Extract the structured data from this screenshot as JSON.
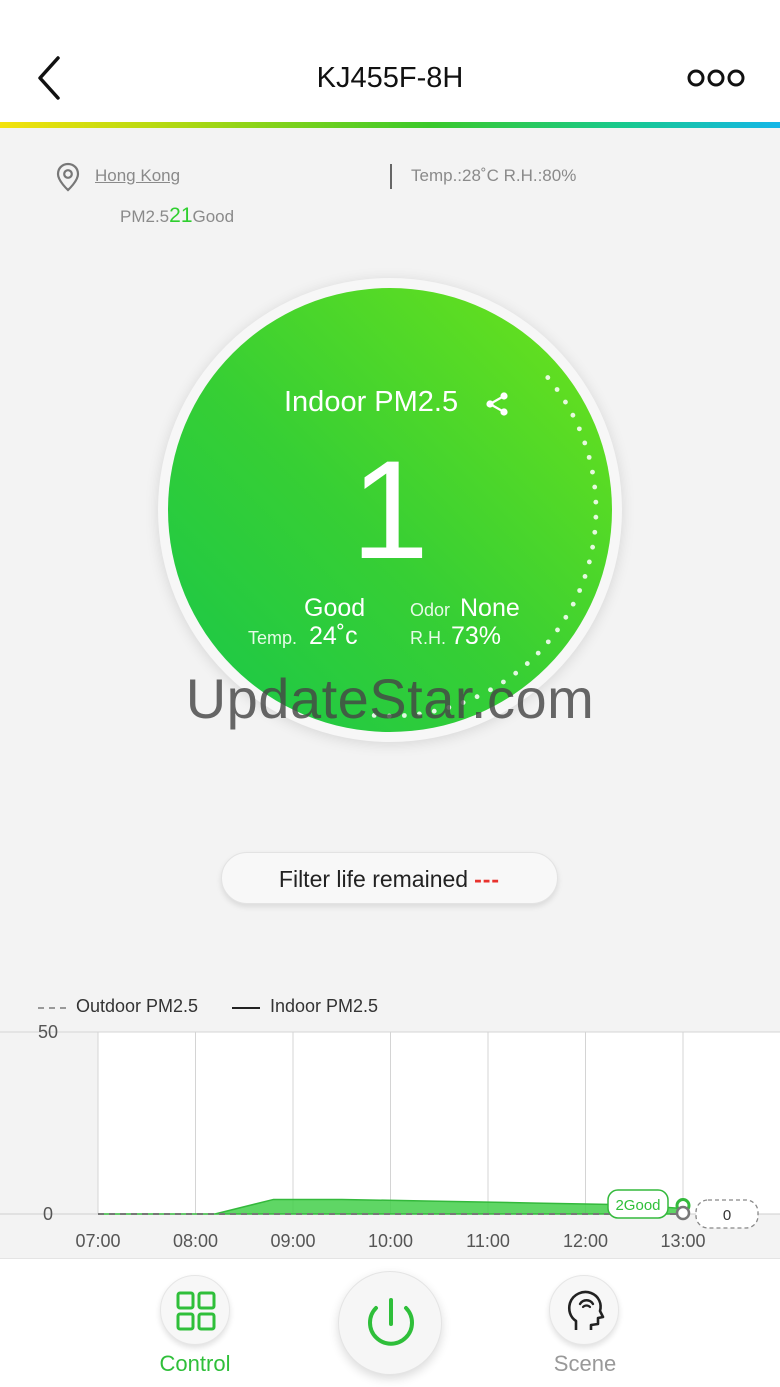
{
  "header": {
    "title": "KJ455F-8H",
    "back_icon": "chevron-left-icon",
    "more_icon": "more-dots-icon"
  },
  "location": {
    "city": "Hong Kong",
    "weather": "Temp.:28˚C R.H.:80%",
    "outdoor_pm_label": "PM2.5",
    "outdoor_pm_value": "21",
    "outdoor_pm_quality": "Good"
  },
  "indoor": {
    "label": "Indoor PM2.5",
    "value": "1",
    "quality": "Good",
    "odor_label": "Odor",
    "odor_value": "None",
    "temp_label": "Temp.",
    "temp_value": "24˚c",
    "rh_label": "R.H.",
    "rh_value": "73%"
  },
  "watermark": "UpdateStar.com",
  "filter": {
    "label": "Filter life remained",
    "value": "---"
  },
  "colors": {
    "accent_green": "#2fbf3a",
    "circle_start": "#18c74a",
    "circle_end": "#6fe31a",
    "filter_dash": "#e8322d"
  },
  "chart_data": {
    "type": "area",
    "legend": [
      "Outdoor PM2.5",
      "Indoor PM2.5"
    ],
    "x": [
      "07:00",
      "08:00",
      "09:00",
      "10:00",
      "11:00",
      "12:00",
      "13:00"
    ],
    "ylim": [
      0,
      50
    ],
    "y_ticks": [
      "50",
      "0"
    ],
    "series": [
      {
        "name": "Indoor PM2.5",
        "x": [
          0,
          1,
          1.2,
          1.8,
          2.5,
          3.5,
          4.5,
          5.5,
          6.0
        ],
        "values": [
          0,
          0,
          0,
          4,
          4,
          3.5,
          3,
          2.5,
          1.5
        ]
      },
      {
        "name": "Outdoor PM2.5",
        "x": [
          0,
          6.0
        ],
        "values": [
          0,
          0
        ]
      }
    ],
    "tooltip": "2Good",
    "end_label": "0"
  },
  "tabs": {
    "control_label": "Control",
    "scene_label": "Scene",
    "control_icon": "grid-icon",
    "power_icon": "power-icon",
    "scene_icon": "head-icon"
  }
}
